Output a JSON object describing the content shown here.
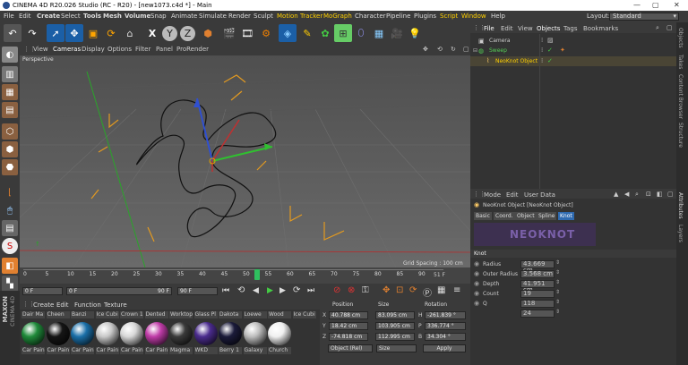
{
  "titlebar": {
    "title": "CINEMA 4D R20.026 Studio (RC - R20) - [new1073.c4d *] - Main"
  },
  "menu": {
    "items": [
      "File",
      "Edit",
      "Create",
      "Select",
      "Tools",
      "Mesh",
      "Volume",
      "Snap",
      "Animate",
      "Simulate",
      "Render",
      "Sculpt",
      "Motion Tracker",
      "MoGraph",
      "Character",
      "Pipeline",
      "Plugins",
      "Script",
      "Window",
      "Help"
    ],
    "layout_label": "Layout:",
    "layout_value": "Standard"
  },
  "viewport": {
    "menu": [
      "View",
      "Cameras",
      "Display",
      "Options",
      "Filter",
      "Panel",
      "ProRender"
    ],
    "name": "Perspective",
    "grid_spacing": "Grid Spacing : 100 cm"
  },
  "timeline": {
    "ticks": [
      "0",
      "5",
      "10",
      "15",
      "20",
      "25",
      "30",
      "35",
      "40",
      "45",
      "50",
      "55",
      "60",
      "65",
      "70",
      "75",
      "80",
      "85",
      "90"
    ],
    "current_marker": "51",
    "end_label": "51 F"
  },
  "transport": {
    "start_frame": "0 F",
    "preview_start": "0 F",
    "preview_end": "90 F",
    "end_frame": "90 F"
  },
  "materials": {
    "menu": [
      "Create",
      "Edit",
      "Function",
      "Texture"
    ],
    "names": [
      "Dair Ma",
      "Cheen",
      "Banzi",
      "Ice Cubi",
      "Crown 1",
      "Dented",
      "Worktop",
      "Glass Pl",
      "Dakota M",
      "Loewe",
      "Wood",
      "Ice Cubi"
    ],
    "labels": [
      "Car Pain",
      "Car Pain",
      "Car Pain",
      "Car Pain",
      "Car Pain",
      "Car Pain",
      "Magma",
      "WKD",
      "Berry 1",
      "Galaxy 1",
      "Church"
    ],
    "colors": [
      "#1f8a3a",
      "#151515",
      "#1a6fa8",
      "#c8c8c8",
      "#d8d8d8",
      "#c03ca8",
      "#3a3a3a",
      "#4b2c8e",
      "#1b1b3a",
      "#bdbdbd",
      "#f0f0f0"
    ]
  },
  "coords": {
    "headers": [
      "Position",
      "Size",
      "Rotation"
    ],
    "rows": [
      {
        "axis": "X",
        "pos": "40.788 cm",
        "size": "83.095 cm",
        "rlabel": "H",
        "rot": "-261.839 °"
      },
      {
        "axis": "Y",
        "pos": "18.42 cm",
        "size": "103.905 cm",
        "rlabel": "P",
        "rot": "336.774 °"
      },
      {
        "axis": "Z",
        "pos": "-74.818 cm",
        "size": "112.995 cm",
        "rlabel": "B",
        "rot": "34.304 °"
      }
    ],
    "mode": "Object (Rel)",
    "size_mode": "Size",
    "apply": "Apply"
  },
  "objmgr": {
    "menu": [
      "File",
      "Edit",
      "View",
      "Objects",
      "Tags",
      "Bookmarks"
    ],
    "objects": [
      "Camera",
      "Sweep",
      "NeoKnot Object"
    ]
  },
  "attrmgr": {
    "menu": [
      "Mode",
      "Edit",
      "User Data"
    ],
    "title": "NeoKnot Object [NeoKnot Object]",
    "tabs": [
      "Basic",
      "Coord.",
      "Object",
      "Spline",
      "Knot"
    ],
    "banner": "NEOKNOT",
    "section": "Knot",
    "fields": [
      {
        "label": "Radius",
        "value": "43.669 cm"
      },
      {
        "label": "Outer Radius",
        "value": "3.568 cm"
      },
      {
        "label": "Depth",
        "value": "41.951 cm"
      },
      {
        "label": "Count",
        "value": "19"
      },
      {
        "label": "Q",
        "value": "118"
      },
      {
        "label": "",
        "value": "24"
      }
    ]
  },
  "rightstrip": {
    "tabs": [
      "Objects",
      "Takes",
      "Content Browser",
      "Structure",
      "Attributes",
      "Layers"
    ]
  },
  "brand": {
    "line1": "MAXON",
    "line2": "CINEMA 4D"
  }
}
